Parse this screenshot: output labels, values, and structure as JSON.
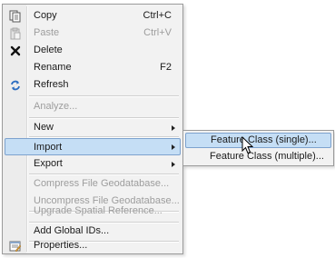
{
  "menu": {
    "items": [
      {
        "label": "Copy",
        "shortcut": "Ctrl+C",
        "icon": "copy-icon",
        "disabled": false
      },
      {
        "label": "Paste",
        "shortcut": "Ctrl+V",
        "icon": "paste-icon",
        "disabled": true
      },
      {
        "label": "Delete",
        "shortcut": "",
        "icon": "delete-icon",
        "disabled": false
      },
      {
        "label": "Rename",
        "shortcut": "F2",
        "icon": "",
        "disabled": false
      },
      {
        "label": "Refresh",
        "shortcut": "",
        "icon": "refresh-icon",
        "disabled": false
      },
      {
        "label": "Analyze...",
        "shortcut": "",
        "icon": "",
        "disabled": true
      },
      {
        "label": "New",
        "shortcut": "",
        "icon": "",
        "disabled": false,
        "submenu": true
      },
      {
        "label": "Import",
        "shortcut": "",
        "icon": "",
        "disabled": false,
        "submenu": true,
        "highlighted": true
      },
      {
        "label": "Export",
        "shortcut": "",
        "icon": "",
        "disabled": false,
        "submenu": true
      },
      {
        "label": "Compress File Geodatabase...",
        "shortcut": "",
        "icon": "",
        "disabled": true
      },
      {
        "label": "Uncompress File Geodatabase...",
        "shortcut": "",
        "icon": "",
        "disabled": true
      },
      {
        "label": "Upgrade Spatial Reference...",
        "shortcut": "",
        "icon": "",
        "disabled": true
      },
      {
        "label": "Add Global IDs...",
        "shortcut": "",
        "icon": "",
        "disabled": false
      },
      {
        "label": "Properties...",
        "shortcut": "",
        "icon": "properties-icon",
        "disabled": false
      }
    ]
  },
  "submenu": {
    "items": [
      {
        "label": "Feature Class (single)...",
        "highlighted": true
      },
      {
        "label": "Feature Class (multiple)...",
        "highlighted": false
      }
    ]
  },
  "colors": {
    "highlight_bg": "#c5def5",
    "highlight_border": "#7da2ce",
    "disabled_text": "#9d9d9d"
  }
}
